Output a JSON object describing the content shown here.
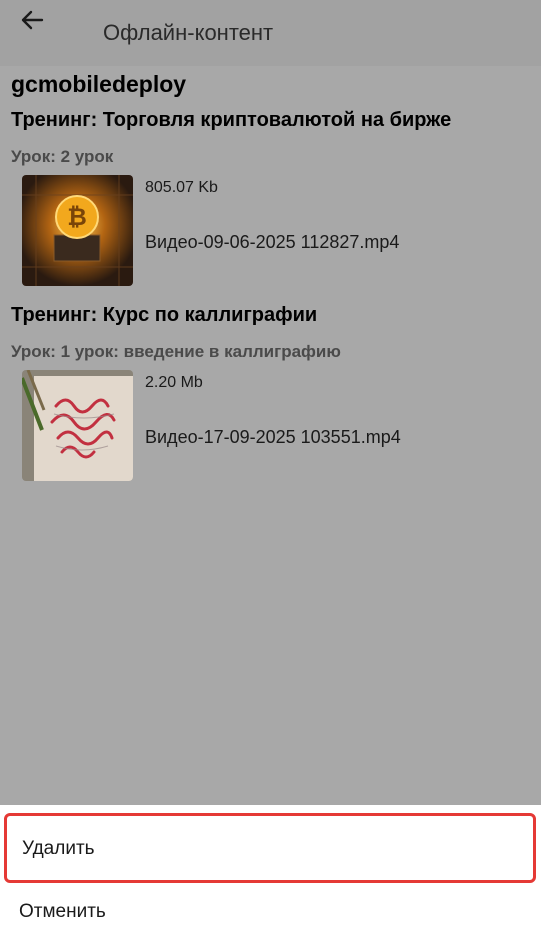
{
  "header": {
    "back_icon": "arrow-left-icon",
    "title": "Офлайн-контент"
  },
  "school_name": "gcmobiledeploy",
  "trainings": [
    {
      "title": "Тренинг: Торговля криптовалютой на бирже",
      "lessons": [
        {
          "title": "Урок: 2 урок",
          "files": [
            {
              "size": "805.07 Kb",
              "name": "Видео-09-06-2025 112827.mp4",
              "thumbnail": "bitcoin-chip-image"
            }
          ]
        }
      ]
    },
    {
      "title": "Тренинг: Курс по каллиграфии",
      "lessons": [
        {
          "title": "Урок: 1 урок: введение в каллиграфию",
          "files": [
            {
              "size": "2.20 Mb",
              "name": "Видео-17-09-2025 103551.mp4",
              "thumbnail": "calligraphy-image"
            }
          ]
        }
      ]
    }
  ],
  "action_sheet": {
    "delete_label": "Удалить",
    "cancel_label": "Отменить",
    "highlight_color": "#e53935"
  },
  "colors": {
    "overlay": "#a8a8a8",
    "sheet": "#ffffff"
  }
}
